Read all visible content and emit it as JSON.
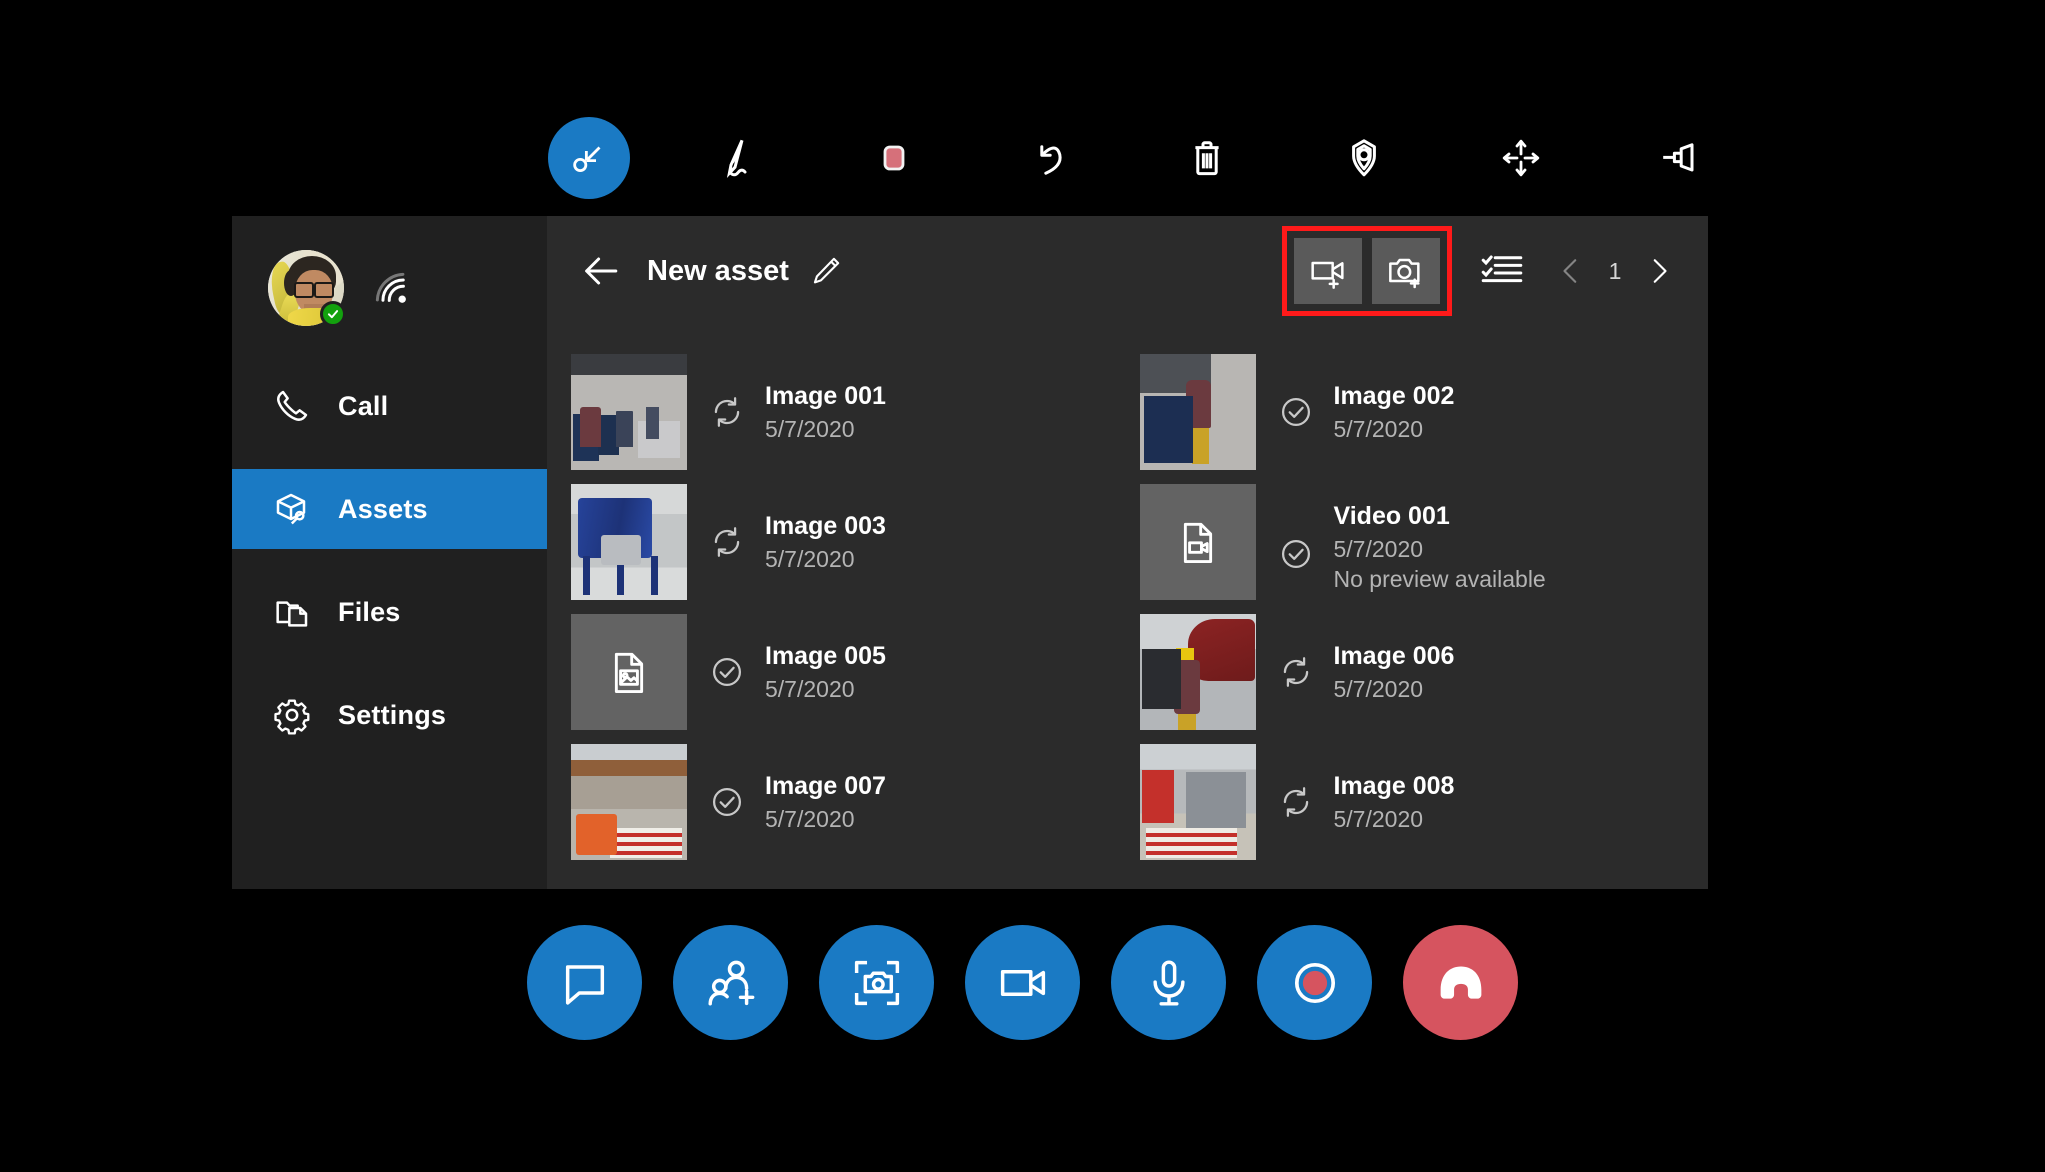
{
  "colors": {
    "accent_blue": "#1a7ac4",
    "panel_bg": "#2b2b2b",
    "sidebar_bg": "#202020",
    "highlight_red": "#ff1a1a",
    "hangup_red": "#d6545f",
    "presence_green": "#13a10e",
    "eraser_red": "#d6707a"
  },
  "annotation_toolbar": {
    "tools": [
      {
        "name": "pointer-arrow-tool",
        "label": "Arrow",
        "active": true
      },
      {
        "name": "pen-tool",
        "label": "Pen",
        "active": false
      },
      {
        "name": "eraser-tool",
        "label": "Eraser",
        "active": false
      },
      {
        "name": "undo-tool",
        "label": "Undo",
        "active": false
      },
      {
        "name": "delete-tool",
        "label": "Delete all",
        "active": false
      },
      {
        "name": "place-marker-tool",
        "label": "Place marker",
        "active": false
      },
      {
        "name": "move-tool",
        "label": "Move",
        "active": false
      },
      {
        "name": "pin-tool",
        "label": "Pin",
        "active": false
      }
    ]
  },
  "sidebar": {
    "profile": {
      "avatar_name": "user-avatar",
      "presence": "available",
      "signal_icon": "wifi-icon"
    },
    "items": [
      {
        "label": "Call",
        "icon": "phone-icon",
        "active": false
      },
      {
        "label": "Assets",
        "icon": "assets-box-icon",
        "active": true
      },
      {
        "label": "Files",
        "icon": "files-folder-icon",
        "active": false
      },
      {
        "label": "Settings",
        "icon": "gear-icon",
        "active": false
      }
    ]
  },
  "content": {
    "header": {
      "back_label": "Back",
      "title": "New asset",
      "edit_label": "Rename",
      "capture_buttons": [
        {
          "name": "add-video-button",
          "icon": "video-plus-icon",
          "label": "Add video"
        },
        {
          "name": "add-photo-button",
          "icon": "camera-plus-icon",
          "label": "Add photo"
        }
      ],
      "list_view_label": "Select items",
      "pager": {
        "prev_label": "Previous page",
        "prev_disabled": true,
        "page": "1",
        "next_label": "Next page",
        "next_disabled": false
      }
    },
    "assets": [
      {
        "name": "Image 001",
        "date": "5/7/2020",
        "note": "",
        "status": "syncing",
        "thumb": "t1",
        "placeholder": ""
      },
      {
        "name": "Image 002",
        "date": "5/7/2020",
        "note": "",
        "status": "synced",
        "thumb": "t2",
        "placeholder": ""
      },
      {
        "name": "Image 003",
        "date": "5/7/2020",
        "note": "",
        "status": "syncing",
        "thumb": "t3",
        "placeholder": ""
      },
      {
        "name": "Video 001",
        "date": "5/7/2020",
        "note": "No preview available",
        "status": "synced",
        "thumb": "",
        "placeholder": "video-file-icon"
      },
      {
        "name": "Image 005",
        "date": "5/7/2020",
        "note": "",
        "status": "synced",
        "thumb": "",
        "placeholder": "image-file-icon"
      },
      {
        "name": "Image 006",
        "date": "5/7/2020",
        "note": "",
        "status": "syncing",
        "thumb": "t6",
        "placeholder": ""
      },
      {
        "name": "Image 007",
        "date": "5/7/2020",
        "note": "",
        "status": "synced",
        "thumb": "t7",
        "placeholder": ""
      },
      {
        "name": "Image 008",
        "date": "5/7/2020",
        "note": "",
        "status": "syncing",
        "thumb": "t8",
        "placeholder": ""
      }
    ]
  },
  "call_bar": {
    "buttons": [
      {
        "name": "chat-button",
        "icon": "chat-bubble-icon",
        "label": "Chat",
        "style": "blue"
      },
      {
        "name": "add-participant-button",
        "icon": "add-person-icon",
        "label": "Add participant",
        "style": "blue"
      },
      {
        "name": "capture-photo-button",
        "icon": "capture-frame-icon",
        "label": "Take photo",
        "style": "blue"
      },
      {
        "name": "toggle-video-button",
        "icon": "video-camera-icon",
        "label": "Video",
        "style": "blue"
      },
      {
        "name": "toggle-mic-button",
        "icon": "microphone-icon",
        "label": "Microphone",
        "style": "blue"
      },
      {
        "name": "record-button",
        "icon": "record-icon",
        "label": "Record",
        "style": "blue"
      },
      {
        "name": "end-call-button",
        "icon": "hangup-icon",
        "label": "End call",
        "style": "red"
      }
    ]
  }
}
